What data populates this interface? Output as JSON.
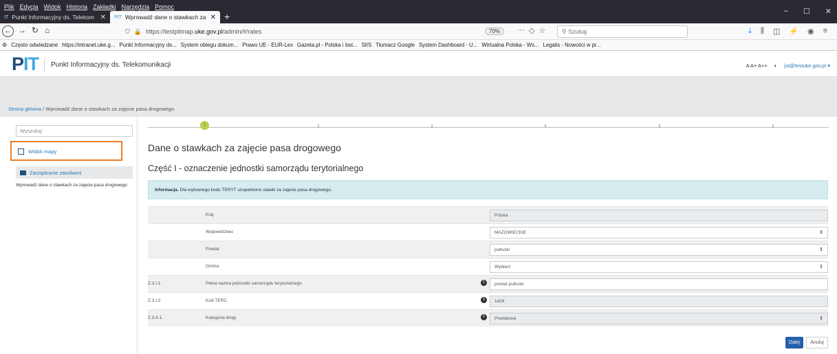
{
  "browser": {
    "menu": [
      "Plik",
      "Edycja",
      "Widok",
      "Historia",
      "Zakładki",
      "Narzędzia",
      "Pomoc"
    ],
    "window_controls": [
      "–",
      "☐",
      "✕"
    ],
    "tabs": [
      {
        "label": "Punkt Informacyjny ds. Telekom",
        "active": false
      },
      {
        "label": "Wprowadź dane o stawkach za",
        "active": true
      }
    ],
    "new_tab": "+",
    "url": {
      "prefix": "https://testpitmap.",
      "domain": "uke.gov.pl",
      "path": "/admin/#/rates"
    },
    "zoom": "70%",
    "search_placeholder": "Szukaj",
    "bookmarks": [
      "Często odwiedzane",
      "https://intranet.uke.g...",
      "Punkt Informacyjny ds...",
      "System obiegu dokum...",
      "Prawo UE - EUR-Lex",
      "Gazeta.pl - Polska i świ...",
      "SIIS",
      "Tłumacz Google",
      "System Dashboard - U...",
      "Wirtualna Polska - Ws...",
      "Legalis - Nowości w pr..."
    ]
  },
  "app": {
    "logo": {
      "p": "P",
      "it": "IT"
    },
    "title": "Punkt Informacyjny ds. Telekomunikacji",
    "font_sizes": "A A+ A++",
    "contrast_icon": "contrast-icon",
    "user": "jst@testuke.gov.pl"
  },
  "breadcrumb": {
    "home": "Strona główna",
    "sep": "/",
    "current": "Wprowadź dane o stawkach za zajęcie pasa drogowego"
  },
  "sidebar": {
    "search_placeholder": "Wyszukaj",
    "map_view": "Widok mapy",
    "resource_mgmt": "Zarządzanie zasobami",
    "link": "Wprowadź dane o stawkach za zajęcie pasa drogowego"
  },
  "stepper": {
    "steps": [
      "1",
      "2",
      "3",
      "4",
      "5",
      "6"
    ],
    "current": 1
  },
  "main": {
    "heading": "Dane o stawkach za zajęcie pasa drogowego",
    "subheading": "Część I - oznaczenie jednostki samorządu terytorialnego",
    "info_bold": "Informacja.",
    "info_text": "Dla wybranego kodu TERYT uzupełniono stawki za zajęcie pasa drogowego."
  },
  "form": [
    {
      "code": "",
      "label": "Kraj",
      "value": "Polska",
      "type": "readonly",
      "info": false
    },
    {
      "code": "",
      "label": "Województwo",
      "value": "MAZOWIECKIE",
      "type": "select",
      "info": false
    },
    {
      "code": "",
      "label": "Powiat",
      "value": "pułtuski",
      "type": "select",
      "info": false
    },
    {
      "code": "",
      "label": "Gmina",
      "value": "Wybierz",
      "type": "select",
      "info": false
    },
    {
      "code": "Z.3.I.1.",
      "label": "Pełna nazwa jednostki samorządu terytorialnego",
      "value": "powiat pułtuski",
      "type": "input",
      "info": true
    },
    {
      "code": "Z.3.I.2.",
      "label": "Kod TERC",
      "value": "1424",
      "type": "readonly",
      "info": true
    },
    {
      "code": "Z.3.II.1.",
      "label": "Kategoria drogi",
      "value": "Powiatowa",
      "type": "readonly-select",
      "info": true
    }
  ],
  "buttons": {
    "next": "Dalej",
    "cancel": "Anuluj"
  }
}
